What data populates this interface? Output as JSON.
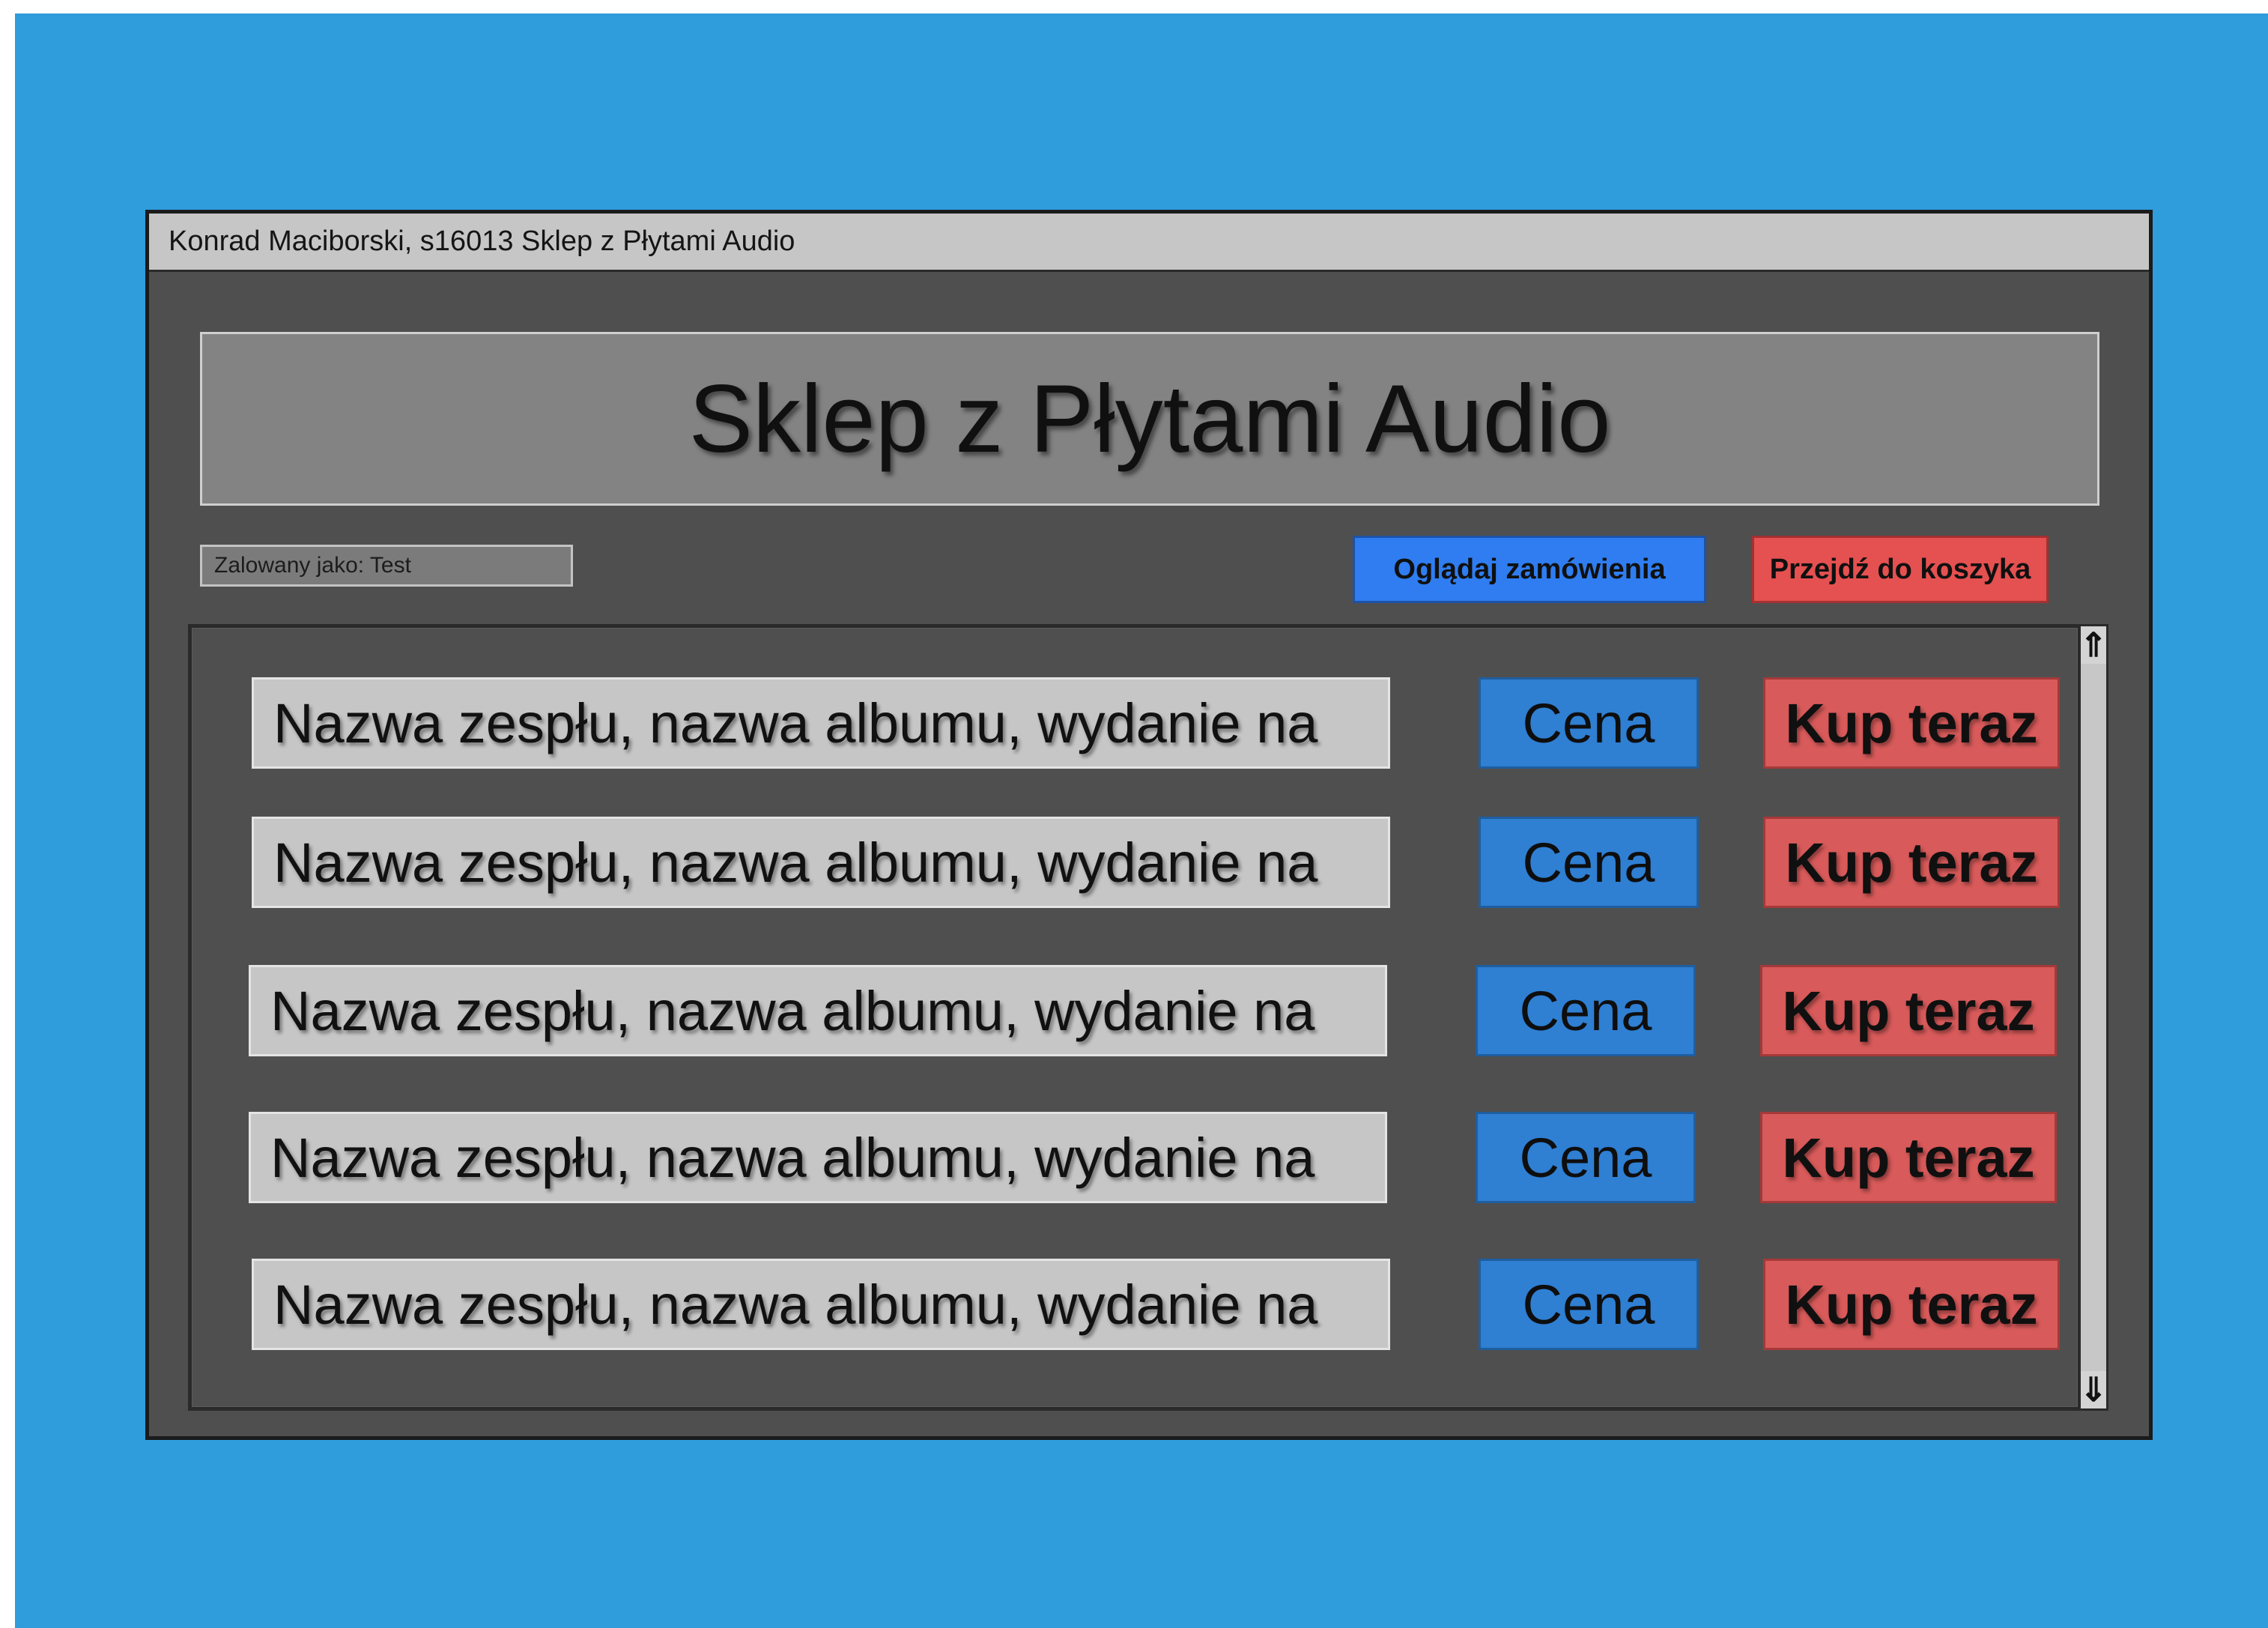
{
  "window": {
    "title": "Konrad Maciborski, s16013 Sklep z Płytami Audio"
  },
  "header": {
    "title": "Sklep z Płytami Audio"
  },
  "status": {
    "login_label": "Zalowany jako: Test"
  },
  "toolbar": {
    "orders_label": "Oglądaj zamówienia",
    "cart_label": "Przejdź do koszyka"
  },
  "products": [
    {
      "name": "Nazwa zespłu, nazwa albumu, wydanie na",
      "price_label": "Cena",
      "buy_label": "Kup teraz"
    },
    {
      "name": "Nazwa zespłu, nazwa albumu, wydanie na",
      "price_label": "Cena",
      "buy_label": "Kup teraz"
    },
    {
      "name": "Nazwa zespłu, nazwa albumu, wydanie na",
      "price_label": "Cena",
      "buy_label": "Kup teraz"
    },
    {
      "name": "Nazwa zespłu, nazwa albumu, wydanie na",
      "price_label": "Cena",
      "buy_label": "Kup teraz"
    },
    {
      "name": "Nazwa zespłu, nazwa albumu, wydanie na",
      "price_label": "Cena",
      "buy_label": "Kup teraz"
    }
  ],
  "scrollbar": {
    "up_icon": "arrow-up-icon",
    "down_icon": "arrow-down-icon"
  },
  "colors": {
    "background": "#2f9cdc",
    "window": "#4f4f4f",
    "accent_blue": "#2f7df0",
    "accent_red": "#e55050"
  }
}
